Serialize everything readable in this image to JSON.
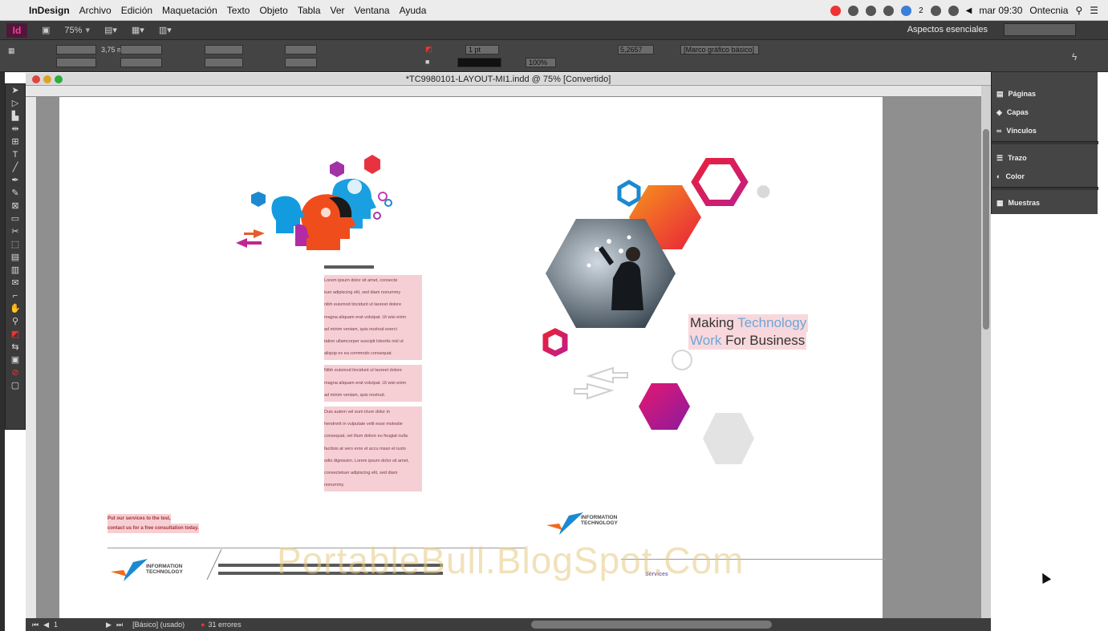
{
  "menubar": {
    "app_name": "InDesign",
    "items": [
      "Archivo",
      "Edición",
      "Maquetación",
      "Texto",
      "Objeto",
      "Tabla",
      "Ver",
      "Ventana",
      "Ayuda"
    ],
    "clock": "mar 09:30",
    "user": "Ontecnia",
    "badge": "2"
  },
  "toolbar": {
    "zoom": "75%",
    "workspace": "Aspectos esenciales",
    "app_icon": "Id"
  },
  "control_panel": {
    "ref_w": "3,75 mm",
    "stroke": "1 pt",
    "opacity": "100%",
    "corner": "5,2657",
    "frame_style": "[Marco gráfico básico]"
  },
  "document": {
    "title": "*TC9980101-LAYOUT-MI1.indd @ 75% [Convertido]"
  },
  "panels": {
    "items": [
      "Páginas",
      "Capas",
      "Vínculos",
      "Trazo",
      "Color",
      "Muestras"
    ]
  },
  "status": {
    "page": "1",
    "style": "[Básico] (usado)",
    "errors": "31 errores"
  },
  "layout": {
    "tagline_1a": "Making ",
    "tagline_1b": "Technology",
    "tagline_2a": "Work",
    "tagline_2b": " For Business",
    "cta_1": "Put our services to the test,",
    "cta_2": "contact us for a free consultation today.",
    "logo_line1": "INFORMATION",
    "logo_line2": "TECHNOLOGY",
    "footer_right": "Services",
    "body_lines_1": [
      "Lorem ipsum dolor sit amet, consecte",
      "tuer adipiscing elit, sed diam nonummy",
      "nibh euismod tincidunt ut laoreet dolore",
      "magna aliquam erat volutpat. Ut wisi enim",
      "ad minim veniam, quis nostrud exerci",
      "tation ullamcorper suscipit lobortis nisl ut",
      "aliquip ex ea commodo consequat."
    ],
    "body_lines_2": [
      "Nibh euismod tincidunt ut laoreet dolore",
      "magna aliquam erat volutpat. Ut wisi enim",
      "ad minim veniam, quis nostrud."
    ],
    "body_lines_3": [
      "Duis autem vel eum iriure dolor in",
      "hendrerit in vulputate velit esse molestie",
      "consequat, vel illum dolore eu feugiat nulla",
      "facilisis at vero eros et accu msan et iusto",
      "odio dignissim. Lorem ipsum dolor sit amet,",
      "consectetuer adipiscing elit, sed diam",
      "nonummy."
    ]
  },
  "watermark": "PortableBull.BlogSpot.Com",
  "colors": {
    "accent_pink": "#e6186f",
    "accent_orange": "#f26a1c",
    "accent_blue": "#1b8ad0",
    "indesign_magenta": "#ff3c9b"
  }
}
